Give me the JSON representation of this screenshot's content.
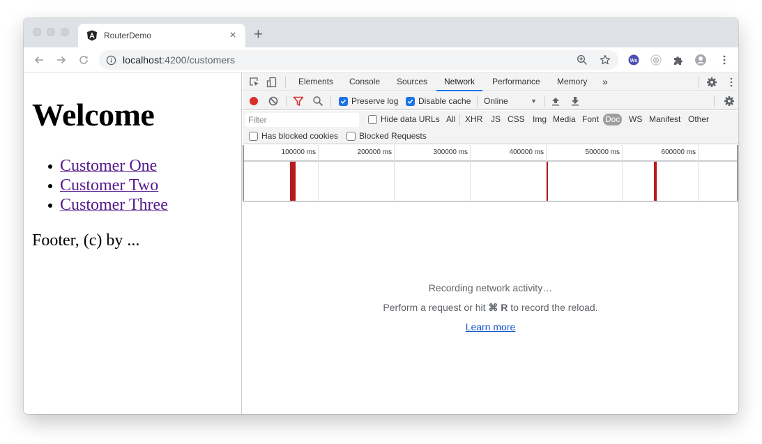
{
  "browser": {
    "tab": {
      "title": "RouterDemo",
      "favicon": "angular-icon",
      "close_glyph": "×"
    },
    "new_tab_glyph": "+",
    "address": {
      "host": "localhost",
      "path": ":4200/customers",
      "info_icon": "info-icon"
    },
    "nav": {
      "back": "back-arrow-icon",
      "forward": "forward-arrow-icon",
      "reload": "reload-icon"
    },
    "extensions": [
      "ws-extension-icon",
      "camera-extension-icon",
      "puzzle-extensions-icon",
      "profile-avatar-icon",
      "kebab-menu-icon"
    ]
  },
  "page": {
    "heading": "Welcome",
    "links": [
      "Customer One",
      "Customer Two",
      "Customer Three"
    ],
    "footer": "Footer, (c) by ..."
  },
  "devtools": {
    "tabs": [
      "Elements",
      "Console",
      "Sources",
      "Network",
      "Performance",
      "Memory"
    ],
    "active_tab": "Network",
    "more_tabs_glyph": "»",
    "toolbar": {
      "preserve_log": {
        "label": "Preserve log",
        "checked": true
      },
      "disable_cache": {
        "label": "Disable cache",
        "checked": true
      },
      "throttling": "Online",
      "throttling_arrow": "▼"
    },
    "filter": {
      "placeholder": "Filter",
      "hide_data_urls": {
        "label": "Hide data URLs",
        "checked": false
      },
      "types": [
        "All",
        "XHR",
        "JS",
        "CSS",
        "Img",
        "Media",
        "Font",
        "Doc",
        "WS",
        "Manifest",
        "Other"
      ],
      "active_type": "Doc",
      "has_blocked_cookies": {
        "label": "Has blocked cookies",
        "checked": false
      },
      "blocked_requests": {
        "label": "Blocked Requests",
        "checked": false
      }
    },
    "overview": {
      "ticks": [
        "100000 ms",
        "200000 ms",
        "300000 ms",
        "400000 ms",
        "500000 ms",
        "600000 ms"
      ],
      "request_markers_ms": [
        62000,
        64000,
        66000,
        68000,
        400000,
        541000,
        543000
      ]
    },
    "empty_state": {
      "line1": "Recording network activity…",
      "line2_prefix": "Perform a request or hit ",
      "line2_key": "⌘ R",
      "line2_suffix": " to record the reload.",
      "learn_more": "Learn more"
    },
    "colors": {
      "accent": "#1a73e8",
      "record": "#d93025",
      "marker": "#b71c1c",
      "filter_active": "#d32f2f"
    }
  }
}
